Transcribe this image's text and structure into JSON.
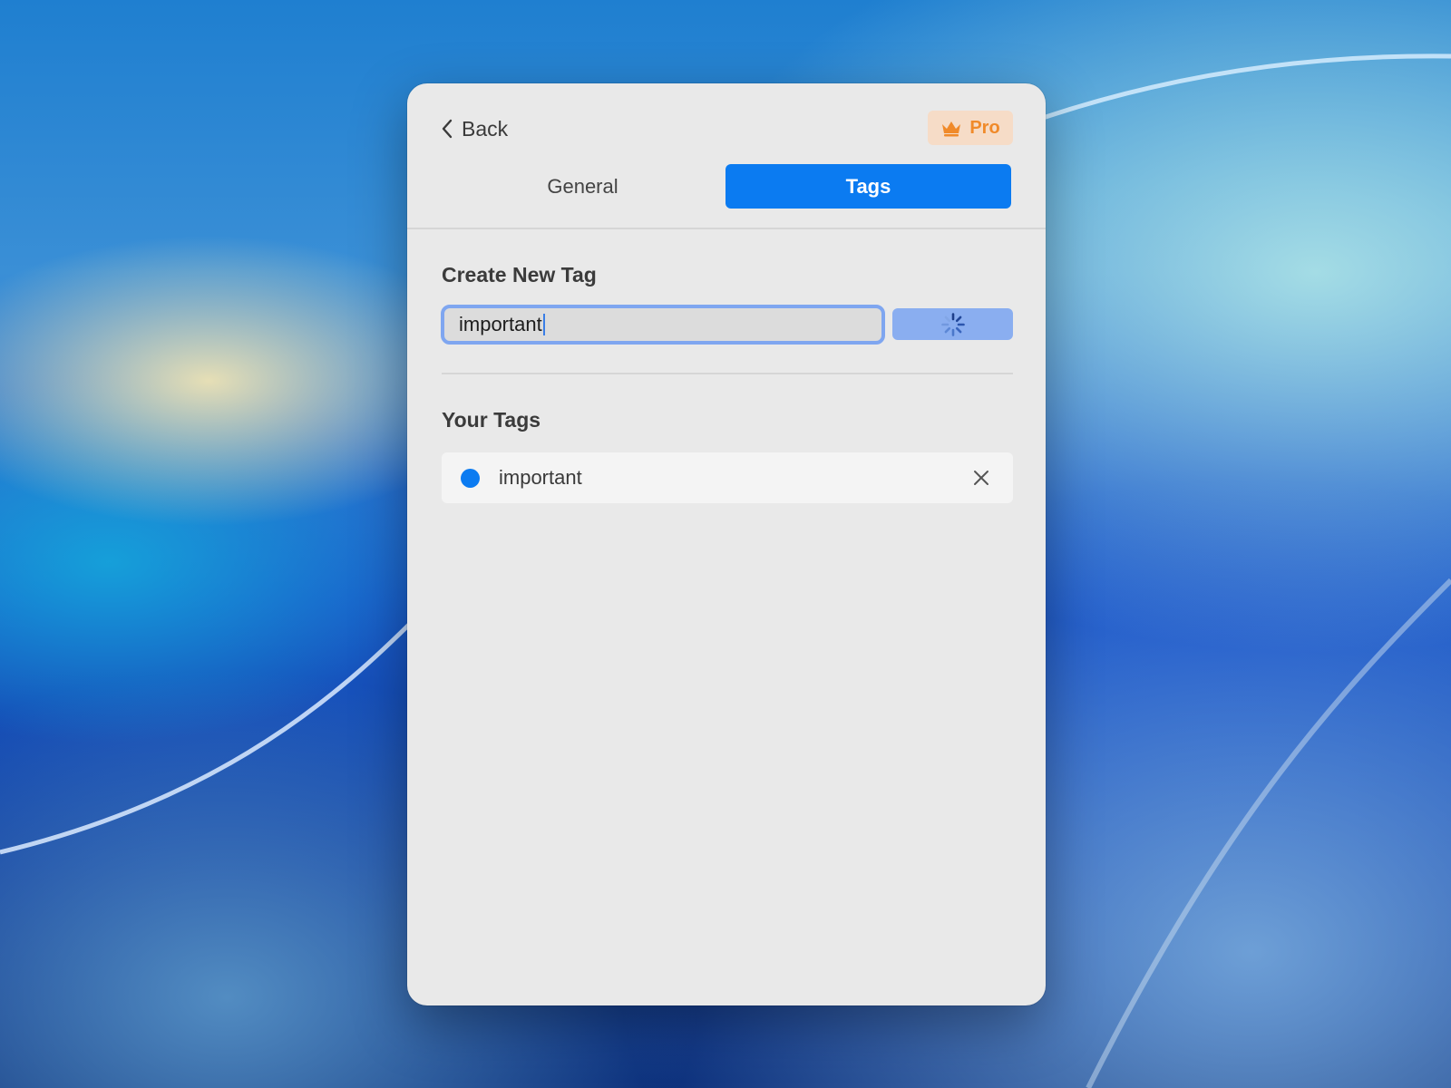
{
  "header": {
    "back_label": "Back",
    "pro_label": "Pro"
  },
  "tabs": [
    {
      "label": "General",
      "active": false
    },
    {
      "label": "Tags",
      "active": true
    }
  ],
  "create_section": {
    "title": "Create New Tag",
    "input_value": "important",
    "add_button_state": "loading",
    "add_button_icon": "spinner-icon"
  },
  "tags_section": {
    "title": "Your Tags",
    "tags": [
      {
        "name": "important",
        "color": "#0b7bf1"
      }
    ]
  },
  "colors": {
    "accent": "#0b7bf1",
    "pro_text": "#f08a2a",
    "pro_bg": "#f6dcc7",
    "window_bg": "#e9e9e9"
  }
}
